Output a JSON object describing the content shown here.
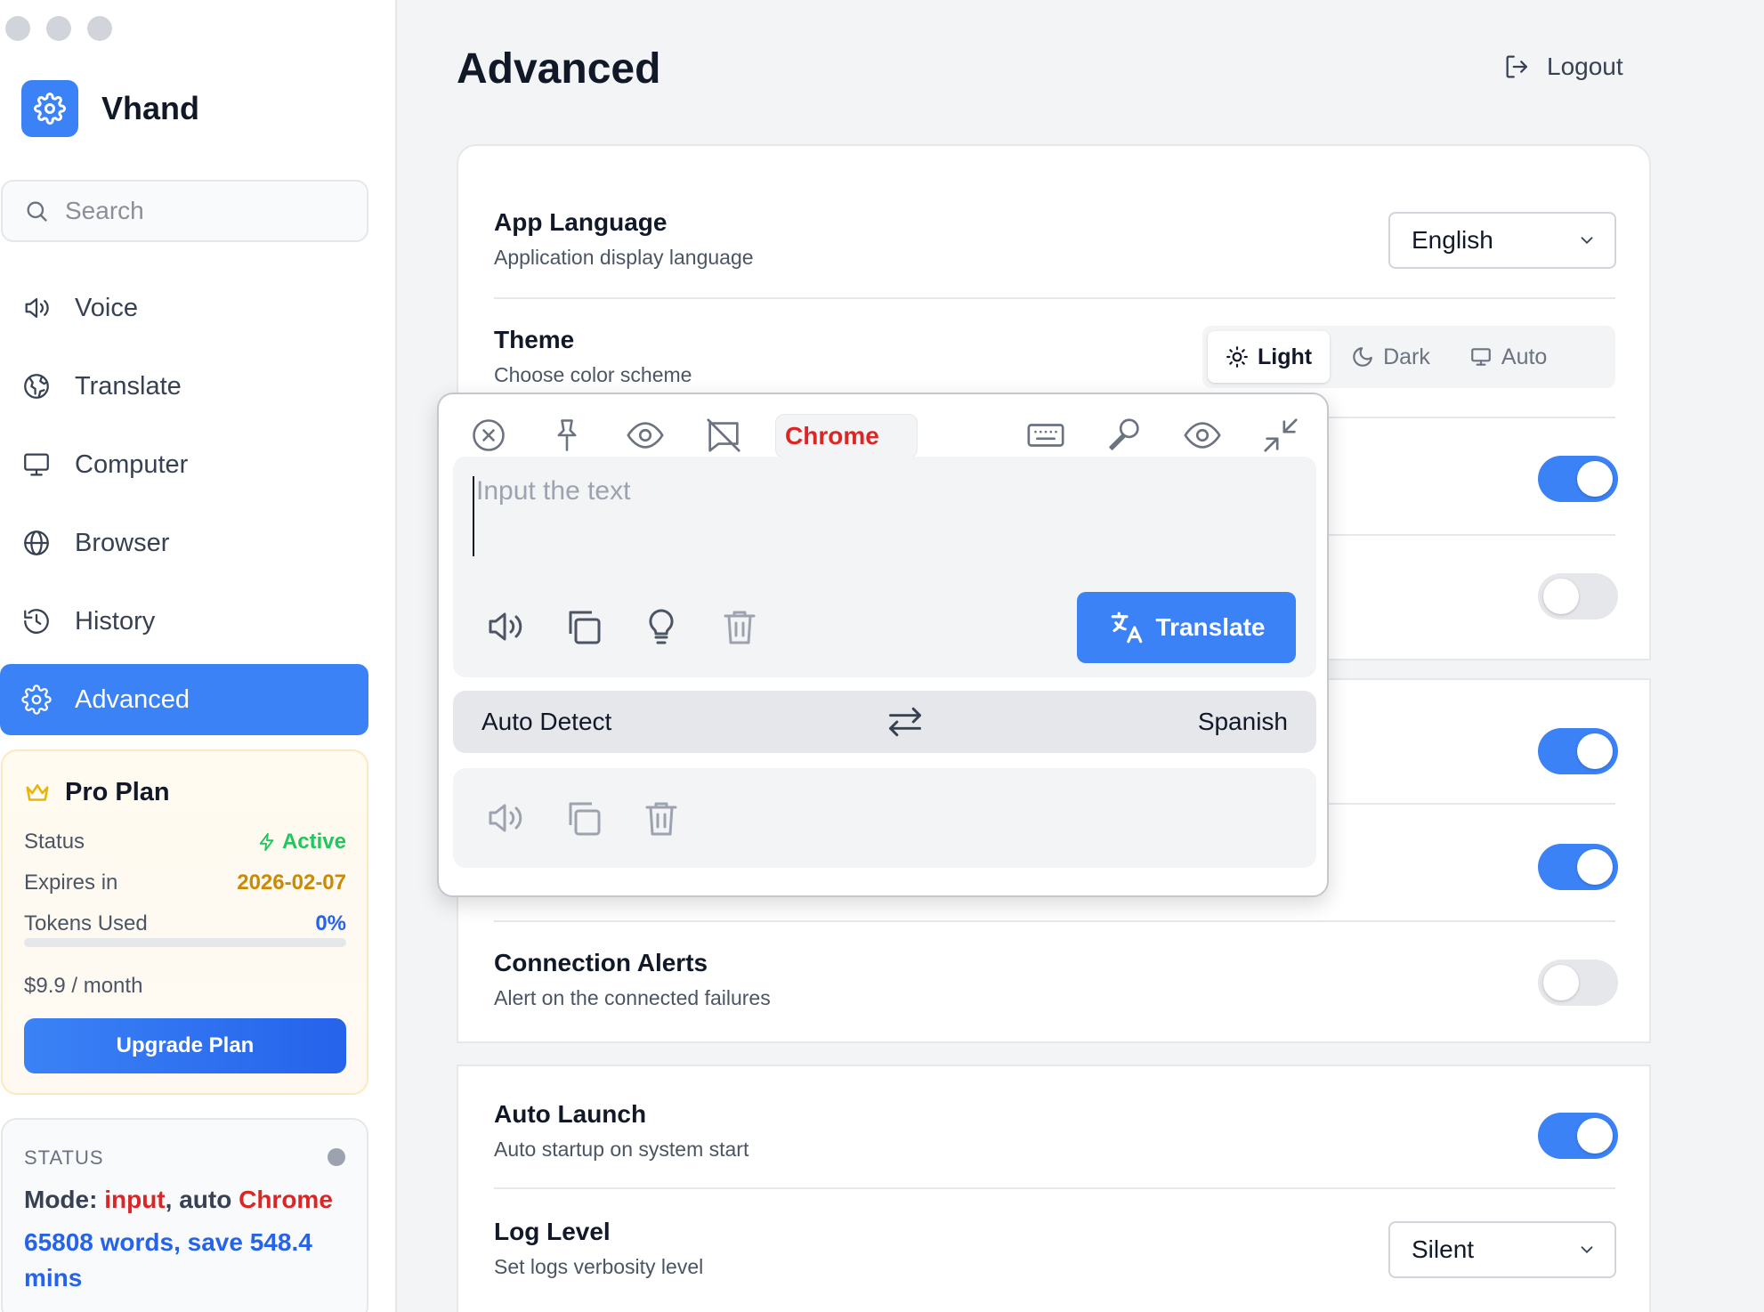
{
  "app": {
    "name": "Vhand"
  },
  "search": {
    "placeholder": "Search"
  },
  "sidebar": {
    "items": [
      {
        "label": "Voice",
        "icon": "speaker-icon"
      },
      {
        "label": "Translate",
        "icon": "globe-pencil-icon"
      },
      {
        "label": "Computer",
        "icon": "monitor-icon"
      },
      {
        "label": "Browser",
        "icon": "globe-icon"
      },
      {
        "label": "History",
        "icon": "history-icon"
      },
      {
        "label": "Advanced",
        "icon": "gear-icon",
        "active": true
      }
    ]
  },
  "plan": {
    "title": "Pro Plan",
    "status_label": "Status",
    "status_value": "Active",
    "expires_label": "Expires in",
    "expires_value": "2026-02-07",
    "tokens_label": "Tokens Used",
    "tokens_value": "0%",
    "tokens_fraction": 0,
    "price": "$9.9 / month",
    "upgrade_label": "Upgrade Plan"
  },
  "status": {
    "label": "STATUS",
    "mode_label": "Mode: ",
    "mode_value": "input",
    "mode_sep": ", auto ",
    "app_value": "Chrome",
    "stats": "65808 words, save 548.4 mins"
  },
  "header": {
    "title": "Advanced",
    "logout_label": "Logout"
  },
  "settings": {
    "app_language": {
      "title": "App Language",
      "subtitle": "Application display language",
      "value": "English"
    },
    "theme": {
      "title": "Theme",
      "subtitle": "Choose color scheme",
      "options": [
        "Light",
        "Dark",
        "Auto"
      ],
      "selected": "Light"
    },
    "toggles_group1": [
      {
        "on": true
      },
      {
        "on": false
      }
    ],
    "toggles_group2": [
      {
        "on": true
      },
      {
        "on": true
      }
    ],
    "connection_alerts": {
      "title": "Connection Alerts",
      "subtitle": "Alert on the connected failures",
      "on": false
    },
    "auto_launch": {
      "title": "Auto Launch",
      "subtitle": "Auto startup on system start",
      "on": true
    },
    "log_level": {
      "title": "Log Level",
      "subtitle": "Set logs verbosity level",
      "value": "Silent"
    }
  },
  "popup": {
    "app_tag": "Chrome",
    "input_placeholder": "Input the text",
    "translate_label": "Translate",
    "source_lang": "Auto Detect",
    "target_lang": "Spanish"
  },
  "colors": {
    "accent": "#3b82f6",
    "danger": "#dc2626",
    "success": "#22c55e",
    "warning": "#ca8a04"
  }
}
